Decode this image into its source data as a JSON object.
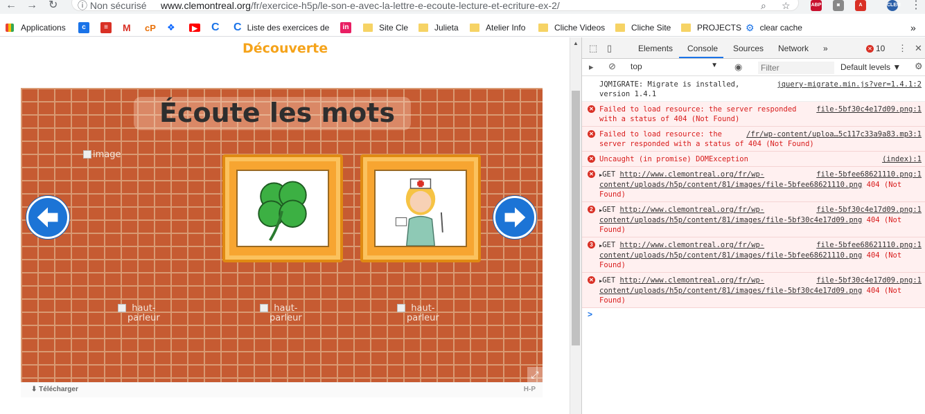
{
  "browser": {
    "security_label": "Non sécurisé",
    "url_host": "www.clemontreal.org",
    "url_path": "/fr/exercice-h5p/le-son-e-avec-la-lettre-e-ecoute-lecture-et-ecriture-ex-2/"
  },
  "extensions": [
    {
      "name": "abp",
      "label": "ABP",
      "color": "#c8102e"
    },
    {
      "name": "camera",
      "label": "",
      "color": "#888888"
    },
    {
      "name": "acrobat",
      "label": "",
      "color": "#d93025"
    },
    {
      "name": "profile",
      "label": "CLEM",
      "color": "#2b5fa8"
    }
  ],
  "bookmarks": {
    "apps_label": "Applications",
    "items": [
      {
        "label": "Liste des exercices de"
      },
      {
        "label": "Site Cle"
      },
      {
        "label": "Julieta"
      },
      {
        "label": "Atelier Info"
      },
      {
        "label": "Cliche Videos"
      },
      {
        "label": "Cliche Site"
      },
      {
        "label": "PROJECTS"
      },
      {
        "label": "clear cache"
      }
    ],
    "overflow": "»"
  },
  "page": {
    "section_title": "Découverte",
    "game_title": "Écoute les mots",
    "broken_image_alt": "image",
    "speaker_alt": "haut-parleur",
    "download_label": "Télécharger",
    "h5p_label": "H-P"
  },
  "devtools": {
    "tabs": [
      "Elements",
      "Console",
      "Sources",
      "Network"
    ],
    "active_tab": "Console",
    "more_tabs": "»",
    "error_count": "10",
    "context": "top",
    "filter_placeholder": "Filter",
    "levels": "Default levels ▼",
    "messages": [
      {
        "type": "info",
        "text": "JQMIGRATE: Migrate is installed, version 1.4.1",
        "source": "jquery-migrate.min.js?ver=1.4.1:2"
      },
      {
        "type": "error",
        "text": "Failed to load resource: the server responded with a status of 404 (Not Found)",
        "source": "file-5bf30c4e17d09.png:1"
      },
      {
        "type": "error",
        "text": "Failed to load resource: the server responded with a status of 404 (Not Found)",
        "source": "/fr/wp-content/uploa…5c117c33a9a83.mp3:1"
      },
      {
        "type": "error",
        "text": "Uncaught (in promise) DOMException",
        "source": "(index):1"
      },
      {
        "type": "error",
        "count": "",
        "verb": "GET",
        "url": "http://www.clemontreal.org/fr/wp-content/uploads/h5p/content/81/images/file-5bfee68621110.png",
        "status": "404 (Not Found)",
        "source": "file-5bfee68621110.png:1"
      },
      {
        "type": "error",
        "count": "2",
        "verb": "GET",
        "url": "http://www.clemontreal.org/fr/wp-content/uploads/h5p/content/81/images/file-5bf30c4e17d09.png",
        "status": "404 (Not Found)",
        "source": "file-5bf30c4e17d09.png:1"
      },
      {
        "type": "error",
        "count": "3",
        "verb": "GET",
        "url": "http://www.clemontreal.org/fr/wp-content/uploads/h5p/content/81/images/file-5bfee68621110.png",
        "status": "404 (Not Found)",
        "source": "file-5bfee68621110.png:1"
      },
      {
        "type": "error",
        "count": "",
        "verb": "GET",
        "url": "http://www.clemontreal.org/fr/wp-content/uploads/h5p/content/81/images/file-5bf30c4e17d09.png",
        "status": "404 (Not Found)",
        "source": "file-5bf30c4e17d09.png:1"
      }
    ],
    "prompt": ">"
  }
}
